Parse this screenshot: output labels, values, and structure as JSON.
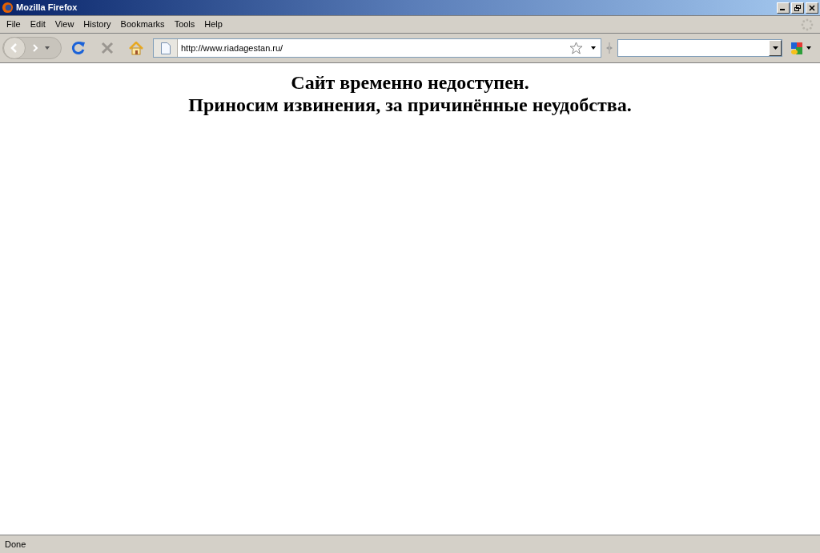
{
  "window": {
    "title": "Mozilla Firefox"
  },
  "menu": [
    "File",
    "Edit",
    "View",
    "History",
    "Bookmarks",
    "Tools",
    "Help"
  ],
  "address_bar": {
    "value": "http://www.riadagestan.ru/"
  },
  "page": {
    "lines": [
      "Сайт временно недоступен.",
      "Приносим извинения, за причинённые неудобства."
    ]
  },
  "status_bar": {
    "text": "Done"
  }
}
